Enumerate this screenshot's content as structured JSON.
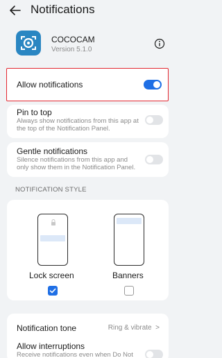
{
  "header": {
    "title": "Notifications"
  },
  "app": {
    "name": "COCOCAM",
    "version": "Version 5.1.0"
  },
  "allow_notifications": {
    "label": "Allow notifications",
    "enabled": true
  },
  "pin_to_top": {
    "label": "Pin to top",
    "description": "Always show notifications from this app at the top of the Notification Panel.",
    "enabled": false
  },
  "gentle_notifications": {
    "label": "Gentle notifications",
    "description": "Silence notifications from this app and only show them in the Notification Panel.",
    "enabled": false
  },
  "notification_style": {
    "section_title": "NOTIFICATION STYLE",
    "options": [
      {
        "label": "Lock screen",
        "checked": true
      },
      {
        "label": "Banners",
        "checked": false
      }
    ]
  },
  "notification_tone": {
    "label": "Notification tone",
    "value": "Ring & vibrate"
  },
  "allow_interruptions": {
    "label": "Allow interruptions",
    "description": "Receive notifications even when Do Not",
    "enabled": false
  },
  "colors": {
    "accent": "#1f6fe5",
    "highlight_border": "#e3262f",
    "app_icon": "#2a86c2"
  }
}
